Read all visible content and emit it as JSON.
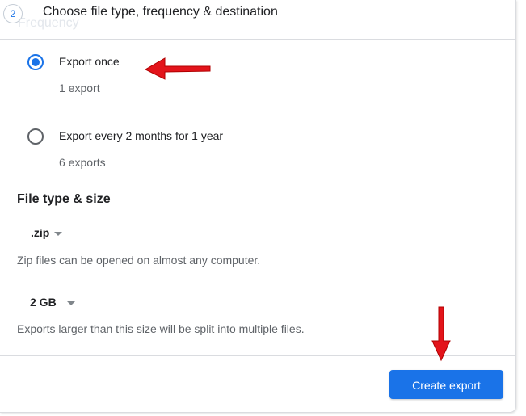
{
  "header": {
    "step_number": "2",
    "title": "Choose file type, frequency & destination",
    "scrolled_section_label": "Frequency"
  },
  "frequency": {
    "options": [
      {
        "label": "Export once",
        "sublabel": "1 export",
        "selected": true
      },
      {
        "label": "Export every 2 months for 1 year",
        "sublabel": "6 exports",
        "selected": false
      }
    ]
  },
  "file_type_size": {
    "title": "File type & size",
    "file_type": {
      "value": ".zip",
      "help": "Zip files can be opened on almost any computer."
    },
    "file_size": {
      "value": "2 GB",
      "help": "Exports larger than this size will be split into multiple files."
    }
  },
  "footer": {
    "create_export_label": "Create export"
  },
  "colors": {
    "accent": "#1a73e8",
    "annotation_arrow": "#e3141b"
  },
  "icons": [
    "radio-checked-icon",
    "radio-unchecked-icon",
    "dropdown-arrow-icon",
    "annotation-arrow-icon"
  ]
}
